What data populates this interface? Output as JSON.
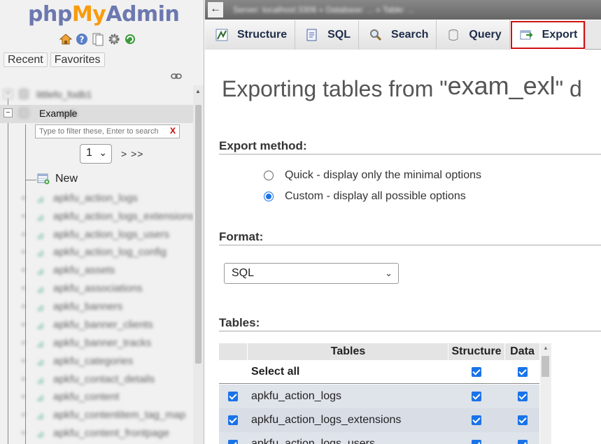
{
  "nav": {
    "logo": {
      "php": "php",
      "my": "My",
      "admin": "Admin"
    },
    "icons": [
      "home-icon",
      "help-icon",
      "docs-icon",
      "settings-icon",
      "reload-icon"
    ],
    "recent_label": "Recent",
    "favorites_label": "Favorites",
    "tree": {
      "db1_name": "littlefo_fodb1",
      "current_db_label": "Example",
      "current_db_blur": "ewh",
      "filter_placeholder": "Type to filter these, Enter to search",
      "filter_clear": "X",
      "page_value": "1",
      "page_next": "> >>",
      "new_label": "New",
      "tables": [
        "apkfu_action_logs",
        "apkfu_action_logs_extensions",
        "apkfu_action_logs_users",
        "apkfu_action_log_config",
        "apkfu_assets",
        "apkfu_associations",
        "apkfu_banners",
        "apkfu_banner_clients",
        "apkfu_banner_tracks",
        "apkfu_categories",
        "apkfu_contact_details",
        "apkfu_content",
        "apkfu_contentitem_tag_map",
        "apkfu_content_frontpage"
      ]
    }
  },
  "main": {
    "breadcrumb": "Server: localhost:3306 » Database: ... » Table: ...",
    "back_label": "←",
    "tabs": [
      {
        "label": "Structure",
        "icon": "structure-icon"
      },
      {
        "label": "SQL",
        "icon": "sql-icon"
      },
      {
        "label": "Search",
        "icon": "search-icon"
      },
      {
        "label": "Query",
        "icon": "query-icon"
      },
      {
        "label": "Export",
        "icon": "export-icon",
        "active": true
      }
    ],
    "title_prefix": "Exporting tables from \"",
    "title_db": "exam_exl",
    "title_suffix": "\" d",
    "export_method": {
      "heading": "Export method:",
      "options": [
        {
          "label": "Quick - display only the minimal options",
          "checked": false
        },
        {
          "label": "Custom - display all possible options",
          "checked": true
        }
      ]
    },
    "format": {
      "heading": "Format:",
      "value": "SQL"
    },
    "tables": {
      "heading": "Tables:",
      "columns": {
        "tables": "Tables",
        "structure": "Structure",
        "data": "Data"
      },
      "select_all": "Select all",
      "rows": [
        "apkfu_action_logs",
        "apkfu_action_logs_extensions",
        "apkfu_action_logs_users"
      ]
    }
  }
}
